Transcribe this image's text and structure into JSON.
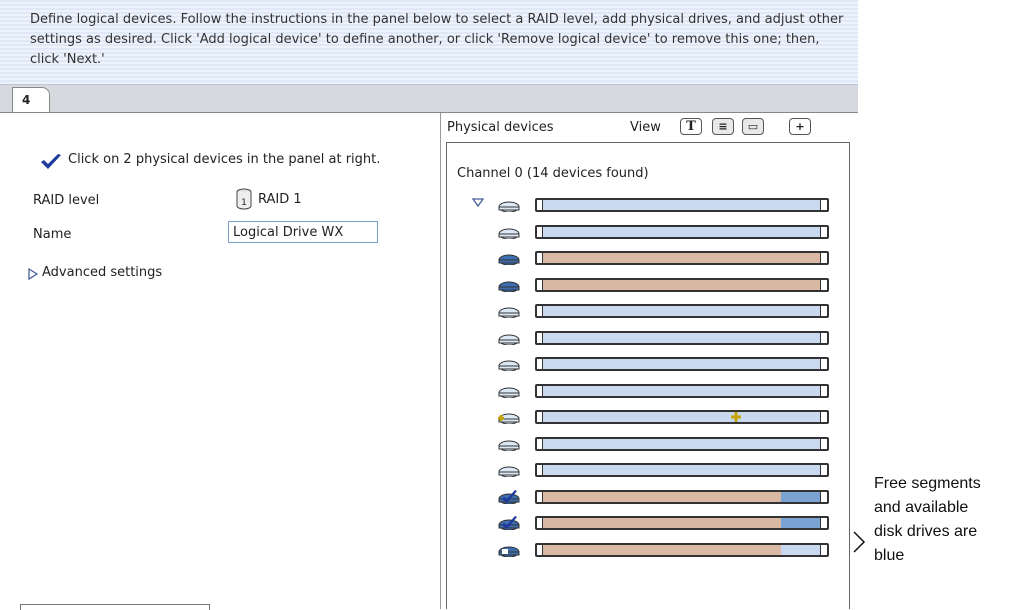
{
  "banner": {
    "text": "Define logical devices.  Follow the instructions in the panel below to select a RAID level, add physical drives, and adjust other settings as desired.  Click 'Add logical device' to define another, or click 'Remove logical device' to remove this one; then, click 'Next.'"
  },
  "tabs": [
    {
      "label": "4"
    }
  ],
  "left": {
    "instruction": "Click on 2 physical devices in the panel at right.",
    "raid_label": "RAID level",
    "raid_value": "RAID 1",
    "raid_icon_text": "1",
    "name_label": "Name",
    "name_value": "Logical Drive WX",
    "advanced": "Advanced settings"
  },
  "right": {
    "title": "Physical devices",
    "view_label": "View",
    "view_buttons": [
      "T",
      "≡",
      "▭",
      "+"
    ],
    "channel": "Channel 0   (14 devices found)",
    "drives": [
      {
        "state": "free",
        "icon": "disk-free-icon",
        "used": 0.0
      },
      {
        "state": "free",
        "icon": "disk-free-icon",
        "used": 0.0
      },
      {
        "state": "used",
        "icon": "disk-used-icon",
        "used": 1.0
      },
      {
        "state": "used",
        "icon": "disk-used-icon",
        "used": 1.0
      },
      {
        "state": "free",
        "icon": "disk-free-icon",
        "used": 0.0
      },
      {
        "state": "free",
        "icon": "disk-free-icon",
        "used": 0.0
      },
      {
        "state": "free",
        "icon": "disk-free-icon",
        "used": 0.0
      },
      {
        "state": "free",
        "icon": "disk-free-icon",
        "used": 0.0
      },
      {
        "state": "spare",
        "icon": "disk-spare-icon",
        "used": 0.0
      },
      {
        "state": "free",
        "icon": "disk-free-icon",
        "used": 0.0
      },
      {
        "state": "free",
        "icon": "disk-free-icon",
        "used": 0.0
      },
      {
        "state": "selected",
        "icon": "disk-selected-icon",
        "used": 0.84
      },
      {
        "state": "selected",
        "icon": "disk-selected-icon",
        "used": 0.84
      },
      {
        "state": "partial",
        "icon": "disk-partial-icon",
        "used": 0.84
      }
    ]
  },
  "callout": {
    "lines": [
      "Free segments",
      "and available",
      "disk drives are",
      "blue"
    ]
  },
  "colors": {
    "banner_bg": "#dfe8f7",
    "free_blue": "#c9d9f0",
    "used_tan": "#d9b9a4",
    "selected_blue": "#7aa3d4",
    "check_blue": "#1f3a9e"
  }
}
